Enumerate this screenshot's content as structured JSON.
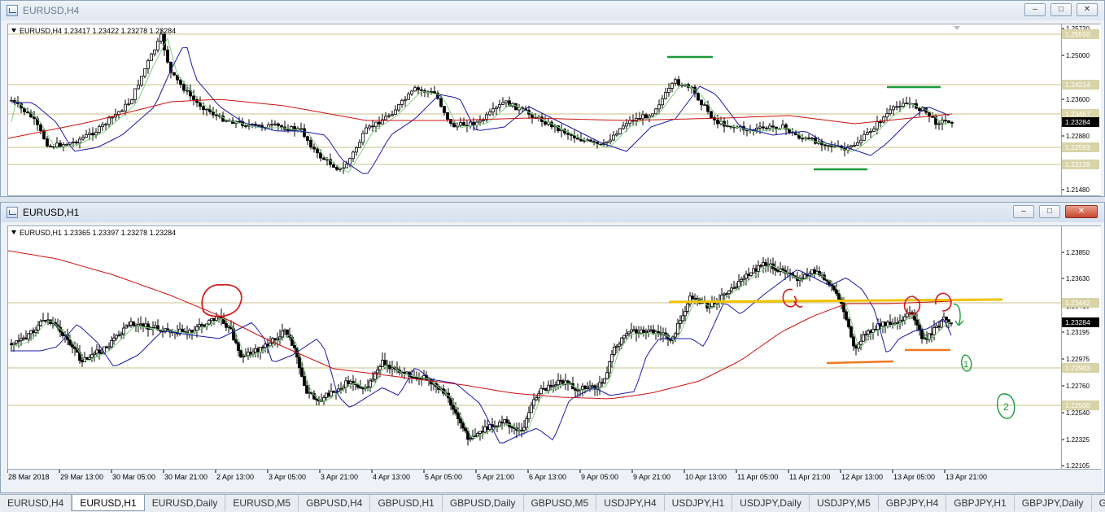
{
  "windows": {
    "h4": {
      "title": "EURUSD,H4",
      "info": "EURUSD,H4  1.23417 1.23422 1.23278 1.23284",
      "price_labels": [
        "1.25720",
        "1.25550",
        "1.25000",
        "1.24214",
        "1.23600",
        "1.23467",
        "1.23284",
        "1.22880",
        "1.22593",
        "1.22128",
        "1.21480"
      ],
      "highlight_labels": [
        {
          "text": "1.25550",
          "kind": "level"
        },
        {
          "text": "1.24214",
          "kind": "level"
        },
        {
          "text": "1.23467",
          "kind": "level"
        },
        {
          "text": "1.23284",
          "kind": "current"
        },
        {
          "text": "1.22593",
          "kind": "level"
        },
        {
          "text": "1.22128",
          "kind": "level"
        }
      ]
    },
    "h1": {
      "title": "EURUSD,H1",
      "info": "EURUSD,H1  1.23365 1.23397 1.23278 1.23284",
      "price_labels": [
        "1.23850",
        "1.23630",
        "1.23410",
        "1.23195",
        "1.22975",
        "1.22760",
        "1.22540",
        "1.22325",
        "1.22105"
      ],
      "highlight_labels": [
        {
          "text": "1.23442",
          "kind": "level"
        },
        {
          "text": "1.23284",
          "kind": "current"
        },
        {
          "text": "1.22903",
          "kind": "level"
        },
        {
          "text": "1.22500",
          "kind": "level"
        }
      ],
      "time_labels": [
        "28 Mar 2018",
        "29 Mar 13:00",
        "30 Mar 05:00",
        "30 Mar 21:00",
        "2 Apr 13:00",
        "3 Apr 05:00",
        "3 Apr 21:00",
        "4 Apr 13:00",
        "5 Apr 05:00",
        "5 Apr 21:00",
        "6 Apr 13:00",
        "9 Apr 05:00",
        "9 Apr 21:00",
        "10 Apr 13:00",
        "11 Apr 05:00",
        "11 Apr 21:00",
        "12 Apr 13:00",
        "13 Apr 05:00",
        "13 Apr 21:00"
      ],
      "annotations": {
        "one": "1",
        "two": "2"
      }
    }
  },
  "colors": {
    "candle": "#000000",
    "ma_fast": "#7fd17f",
    "ma_mid": "#1a1aa8",
    "ma_slow": "#cc1111",
    "level_line": "#c8c08a",
    "green_mark": "#1a9a3a",
    "yellow_line": "#f2c200",
    "orange_line": "#f07820",
    "red_draw": "#d41c1c"
  },
  "tabs": [
    {
      "label": "EURUSD,H4",
      "active": false
    },
    {
      "label": "EURUSD,H1",
      "active": true
    },
    {
      "label": "EURUSD,Daily",
      "active": false
    },
    {
      "label": "EURUSD,M5",
      "active": false
    },
    {
      "label": "GBPUSD,H4",
      "active": false
    },
    {
      "label": "GBPUSD,H1",
      "active": false
    },
    {
      "label": "GBPUSD,Daily",
      "active": false
    },
    {
      "label": "GBPUSD,M5",
      "active": false
    },
    {
      "label": "USDJPY,H4",
      "active": false
    },
    {
      "label": "USDJPY,H1",
      "active": false
    },
    {
      "label": "USDJPY,Daily",
      "active": false
    },
    {
      "label": "USDJPY,M5",
      "active": false
    },
    {
      "label": "GBPJPY,H4",
      "active": false
    },
    {
      "label": "GBPJPY,H1",
      "active": false
    },
    {
      "label": "GBPJPY,Daily",
      "active": false
    },
    {
      "label": "GBP",
      "active": false
    }
  ]
}
